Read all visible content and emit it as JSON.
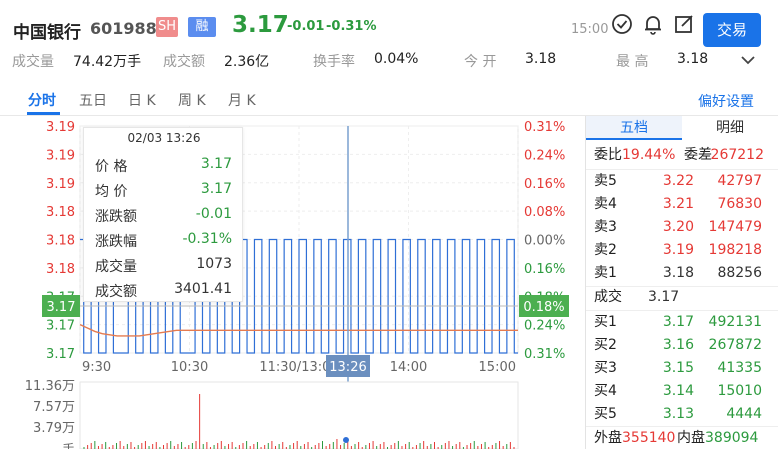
{
  "header": {
    "name": "中国银行",
    "code": "601988",
    "badge_sh": "SH",
    "badge_margin": "融",
    "price": "3.17",
    "change": "-0.01",
    "change_pct": "-0.31%",
    "time": "15:00",
    "trade_button": "交易"
  },
  "stats": [
    {
      "label": "成交量",
      "value": "74.42万手"
    },
    {
      "label": "成交额",
      "value": "2.36亿"
    },
    {
      "label": "换手率",
      "value": "0.04%"
    },
    {
      "label": "今 开",
      "value": "3.18"
    },
    {
      "label": "最 高",
      "value": "3.18"
    }
  ],
  "tabs": [
    "分时",
    "五日",
    "日 K",
    "周 K",
    "月 K"
  ],
  "settings_link": "偏好设置",
  "chart_data": {
    "type": "line",
    "price_axis_left": [
      "3.19",
      "3.19",
      "3.19",
      "3.18",
      "3.18",
      "3.18",
      "3.17",
      "3.17",
      "3.17"
    ],
    "pct_axis_right": [
      "0.31%",
      "0.24%",
      "0.16%",
      "0.08%",
      "0.00%",
      "0.16%",
      "0.18%",
      "0.24%",
      "0.31%"
    ],
    "x_ticks": [
      "9:30",
      "10:30",
      "11:30/13:00",
      "14:00",
      "15:00"
    ],
    "price_range": [
      3.17,
      3.19
    ],
    "prev_close": 3.18,
    "current_price_label": "3.17",
    "current_pct_label": "0.18%",
    "crosshair_time": "13:26",
    "volume_axis": [
      "11.36万",
      "7.57万",
      "3.79万",
      "手"
    ],
    "series": [
      {
        "values": [
          3.18,
          3.17,
          3.18,
          3.17,
          3.18,
          3.17,
          3.17,
          3.18,
          3.17,
          3.18,
          3.17,
          3.18,
          3.17,
          3.18,
          3.17,
          3.17,
          3.18,
          3.17,
          3.18,
          3.17,
          3.18,
          3.17,
          3.18,
          3.17,
          3.18,
          3.17,
          3.18,
          3.17,
          3.18,
          3.17,
          3.18,
          3.17,
          3.18,
          3.17,
          3.18,
          3.17,
          3.18,
          3.17,
          3.18,
          3.17,
          3.18,
          3.17,
          3.18,
          3.17,
          3.18,
          3.17,
          3.18,
          3.17,
          3.18,
          3.17,
          3.18,
          3.17,
          3.18,
          3.17,
          3.18,
          3.17,
          3.18,
          3.17,
          3.18,
          3.17
        ]
      },
      {
        "values": [
          3.1725,
          3.1722,
          3.1719,
          3.1717,
          3.1716,
          3.1715,
          3.1715,
          3.1715,
          3.1715,
          3.1716,
          3.1717,
          3.1718,
          3.1719,
          3.172,
          3.172,
          3.172,
          3.172,
          3.172,
          3.172,
          3.172,
          3.172,
          3.172,
          3.172,
          3.172,
          3.172,
          3.172,
          3.172,
          3.172,
          3.172,
          3.172,
          3.172,
          3.172,
          3.172,
          3.172,
          3.172,
          3.172,
          3.172,
          3.172,
          3.172,
          3.172,
          3.172,
          3.172,
          3.172,
          3.172,
          3.172,
          3.172,
          3.172,
          3.172,
          3.172,
          3.172,
          3.172,
          3.172,
          3.172,
          3.172,
          3.172,
          3.172,
          3.172,
          3.172,
          3.172,
          3.172
        ]
      }
    ]
  },
  "tooltip": {
    "title": "02/03 13:26",
    "rows": [
      {
        "label": "价 格",
        "value": "3.17"
      },
      {
        "label": "均 价",
        "value": "3.17"
      },
      {
        "label": "涨跌额",
        "value": "-0.01"
      },
      {
        "label": "涨跌幅",
        "value": "-0.31%"
      },
      {
        "label": "成交量",
        "value": "1073"
      },
      {
        "label": "成交额",
        "value": "3401.41"
      }
    ]
  },
  "side": {
    "tab_active": "五档",
    "tab_other": "明细",
    "wei_bi_label": "委比",
    "wei_bi": "19.44%",
    "wei_cha_label": "委差",
    "wei_cha": "267212",
    "asks": [
      {
        "label": "卖5",
        "price": "3.22",
        "vol": "42797"
      },
      {
        "label": "卖4",
        "price": "3.21",
        "vol": "76830"
      },
      {
        "label": "卖3",
        "price": "3.20",
        "vol": "147479"
      },
      {
        "label": "卖2",
        "price": "3.19",
        "vol": "198218"
      },
      {
        "label": "卖1",
        "price": "3.18",
        "vol": "88256"
      }
    ],
    "last_label": "成交",
    "last_price": "3.17",
    "bids": [
      {
        "label": "买1",
        "price": "3.17",
        "vol": "492131"
      },
      {
        "label": "买2",
        "price": "3.16",
        "vol": "267872"
      },
      {
        "label": "买3",
        "price": "3.15",
        "vol": "41335"
      },
      {
        "label": "买4",
        "price": "3.14",
        "vol": "15010"
      },
      {
        "label": "买5",
        "price": "3.13",
        "vol": "4444"
      }
    ],
    "outer_label": "外盘",
    "outer": "355140",
    "inner_label": "内盘",
    "inner": "389094"
  },
  "colors": {
    "up": "#e53935",
    "down": "#2c9a3e",
    "accent": "#1a73e8"
  }
}
